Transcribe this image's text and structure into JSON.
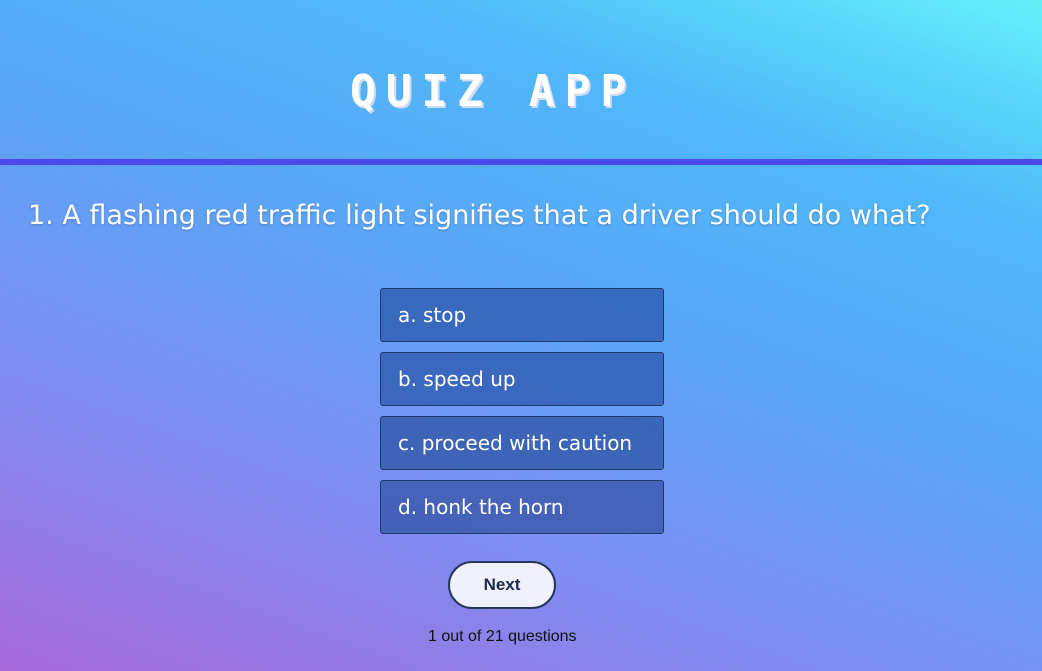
{
  "header": {
    "title": "QUIZ APP"
  },
  "question": {
    "text": "1. A flashing red traffic light signifies that a driver should do what?"
  },
  "options": [
    {
      "label": "a. stop"
    },
    {
      "label": "b. speed up"
    },
    {
      "label": "c. proceed with caution"
    },
    {
      "label": "d. honk the horn"
    }
  ],
  "controls": {
    "next_label": "Next"
  },
  "progress": {
    "text": "1 out of 21 questions"
  },
  "colors": {
    "divider": "#4b49ec",
    "gradient_top": "#64f0fa",
    "gradient_bottom": "#a66ad9"
  }
}
